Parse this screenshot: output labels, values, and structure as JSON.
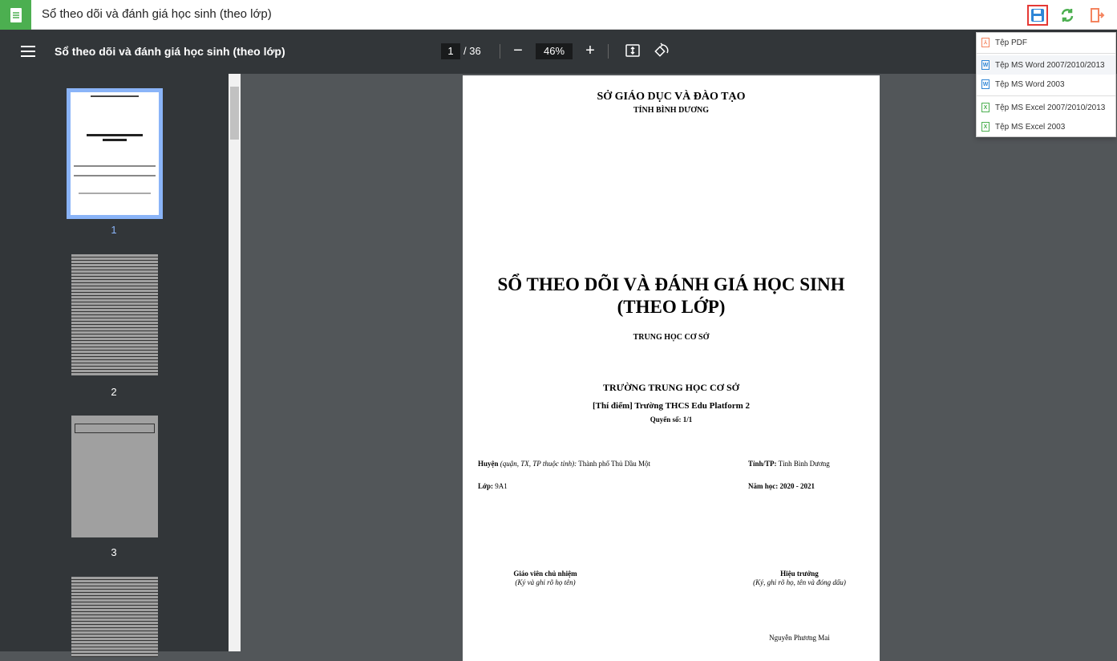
{
  "window": {
    "title": "Sổ theo dõi và đánh giá học sinh (theo lớp)"
  },
  "viewer": {
    "title": "Sổ theo dõi và đánh giá học sinh (theo lớp)",
    "page": "1",
    "total": "/ 36",
    "zoom": "46%"
  },
  "thumbnails": [
    "1",
    "2",
    "3"
  ],
  "export_menu": [
    "Tệp PDF",
    "Tệp MS Word 2007/2010/2013",
    "Tệp MS Word 2003",
    "Tệp MS Excel 2007/2010/2013",
    "Tệp MS Excel 2003"
  ],
  "doc": {
    "dept": "SỞ GIÁO DỤC VÀ ĐÀO TẠO",
    "province": "TỈNH BÌNH DƯƠNG",
    "title1": "SỔ THEO DÕI VÀ ĐÁNH GIÁ HỌC SINH",
    "title2": "(THEO LỚP)",
    "level": "TRUNG HỌC CƠ SỞ",
    "school_type": "TRƯỜNG TRUNG HỌC CƠ SỞ",
    "school": "[Thí điểm] Trường THCS Edu Platform 2",
    "book": "Quyển số: 1/1",
    "district_label": "Huyện",
    "district_hint": "(quận, TX, TP thuộc tỉnh):",
    "district": "Thành phố Thủ Dầu Một",
    "province_label": "Tỉnh/TP:",
    "province_value": "Tỉnh Bình Dương",
    "class_label": "Lớp:",
    "class_value": "9A1",
    "year_label": "Năm học:",
    "year_value": "2020 - 2021",
    "teacher_label": "Giáo viên chủ nhiệm",
    "teacher_hint": "(Ký và ghi rõ họ tên)",
    "principal_label": "Hiệu trưởng",
    "principal_hint": "(Ký, ghi rõ họ, tên và đóng dấu)",
    "principal_name": "Nguyễn Phương Mai"
  }
}
